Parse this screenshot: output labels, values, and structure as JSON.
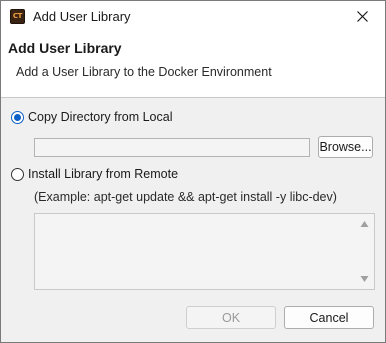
{
  "window": {
    "title": "Add User Library",
    "app_icon_text": "CT",
    "accent_color": "#0b5fc7"
  },
  "header": {
    "title": "Add User Library",
    "description": "Add a User Library to the Docker Environment"
  },
  "options": {
    "local": {
      "label": "Copy Directory from Local",
      "selected": true,
      "directory_value": "",
      "browse_label": "Browse..."
    },
    "remote": {
      "label": "Install Library from Remote",
      "selected": false,
      "example": "(Example: apt-get update && apt-get install -y libc-dev)",
      "commands_value": ""
    }
  },
  "footer": {
    "ok_label": "OK",
    "ok_enabled": false,
    "cancel_label": "Cancel"
  },
  "icons": {
    "close": "close-icon",
    "scroll_up": "arrow-up-icon",
    "scroll_down": "arrow-down-icon"
  }
}
